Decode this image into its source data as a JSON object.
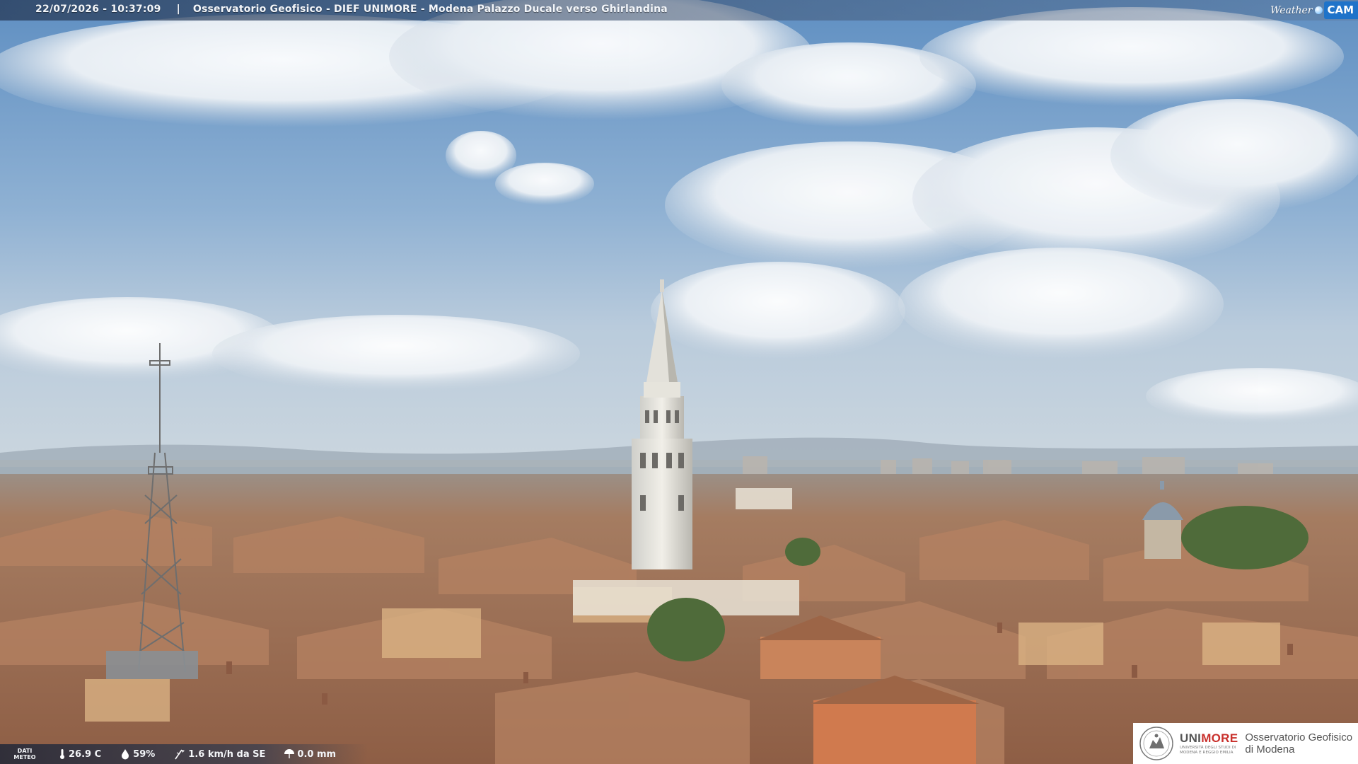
{
  "header": {
    "timestamp": "22/07/2026 - 10:37:09",
    "separator": "|",
    "location": "Osservatorio Geofisico - DIEF UNIMORE - Modena Palazzo Ducale verso Ghirlandina",
    "brand_weather": "Weather",
    "brand_cam": "CAM"
  },
  "meteo": {
    "label_line1": "DATI",
    "label_line2": "METEO",
    "temperature": "26.9 C",
    "humidity": "59%",
    "wind": "1.6 km/h da SE",
    "rain": "0.0 mm"
  },
  "logo": {
    "uni_prefix": "UNI",
    "uni_suffix": "MORE",
    "uni_sub_line1": "UNIVERSITÀ DEGLI STUDI DI",
    "uni_sub_line2": "MODENA E REGGIO EMILIA",
    "obs_line1": "Osservatorio Geofisico",
    "obs_line2": "di Modena"
  },
  "colors": {
    "sky_top": "#6f9bc8",
    "sky_bottom": "#c7d6e2",
    "roof": "#a9765a",
    "cam_blue": "#1f73c9",
    "unimore_red": "#c9302c"
  }
}
